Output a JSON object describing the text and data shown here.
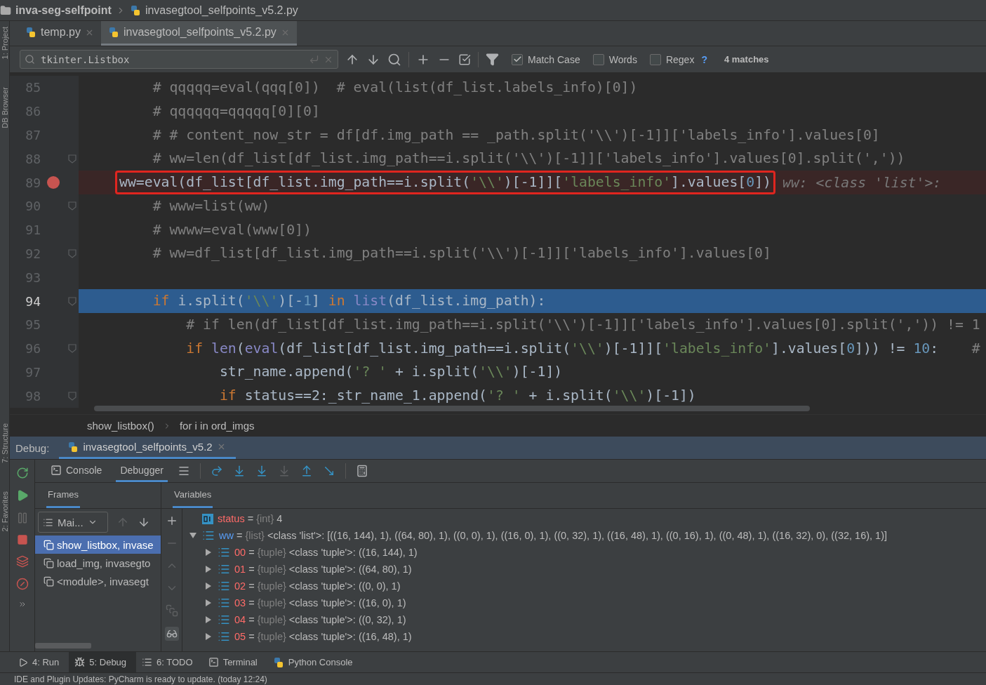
{
  "breadcrumb": {
    "project": "inva-seg-selfpoint",
    "file": "invasegtool_selfpoints_v5.2.py"
  },
  "left_strip": [
    {
      "label": "1: Project"
    },
    {
      "label": "DB Browser"
    },
    {
      "label": "7: Structure"
    },
    {
      "label": "2: Favorites"
    }
  ],
  "editor_tabs": [
    {
      "label": "temp.py",
      "selected": false
    },
    {
      "label": "invasegtool_selfpoints_v5.2.py",
      "selected": true
    }
  ],
  "find_bar": {
    "value": "tkinter.Listbox",
    "options": [
      {
        "label": "Match Case",
        "checked": true
      },
      {
        "label": "Words",
        "checked": false
      },
      {
        "label": "Regex",
        "checked": false
      }
    ],
    "help": "?",
    "matches": "4 matches"
  },
  "code_lines": [
    {
      "number": "85",
      "fold": false,
      "breakpoint": false,
      "current": false,
      "boxed": false,
      "tokens": [
        {
          "kind": "comment",
          "text": "    # qqqqq=eval(qqq[0])  # eval(list(df_list.labels_info)[0])"
        }
      ]
    },
    {
      "number": "86",
      "fold": false,
      "breakpoint": false,
      "current": false,
      "boxed": false,
      "tokens": [
        {
          "kind": "comment",
          "text": "    # qqqqqq=qqqqq[0][0]"
        }
      ]
    },
    {
      "number": "87",
      "fold": false,
      "breakpoint": false,
      "current": false,
      "boxed": false,
      "tokens": [
        {
          "kind": "comment",
          "text": "    # # content_now_str = df[df.img_path == _path.split('\\\\')[-1]]['labels_info'].values[0]"
        }
      ]
    },
    {
      "number": "88",
      "fold": true,
      "breakpoint": false,
      "current": false,
      "boxed": false,
      "tokens": [
        {
          "kind": "comment",
          "text": "    # ww=len(df_list[df_list.img_path==i.split('\\\\')[-1]]['labels_info'].values[0].split(','))"
        }
      ]
    },
    {
      "number": "89",
      "fold": false,
      "breakpoint": true,
      "current": false,
      "boxed": true,
      "hint": "ww: <class 'list'>:",
      "tokens": [
        {
          "kind": "plain",
          "text": "ww=eval(df_list[df_list.img_path==i.split("
        },
        {
          "kind": "string",
          "text": "'\\\\'"
        },
        {
          "kind": "plain",
          "text": ")[-1]]["
        },
        {
          "kind": "string",
          "text": "'labels_info'"
        },
        {
          "kind": "plain",
          "text": "].values["
        },
        {
          "kind": "number",
          "text": "0"
        },
        {
          "kind": "plain",
          "text": "])"
        }
      ]
    },
    {
      "number": "90",
      "fold": true,
      "breakpoint": false,
      "current": false,
      "boxed": false,
      "tokens": [
        {
          "kind": "comment",
          "text": "    # www=list(ww)"
        }
      ]
    },
    {
      "number": "91",
      "fold": false,
      "breakpoint": false,
      "current": false,
      "boxed": false,
      "tokens": [
        {
          "kind": "comment",
          "text": "    # wwww=eval(www[0])"
        }
      ]
    },
    {
      "number": "92",
      "fold": true,
      "breakpoint": false,
      "current": false,
      "boxed": false,
      "tokens": [
        {
          "kind": "comment",
          "text": "    # ww=df_list[df_list.img_path==i.split('\\\\')[-1]]['labels_info'].values[0]"
        }
      ]
    },
    {
      "number": "93",
      "fold": false,
      "breakpoint": false,
      "current": false
    },
    {
      "number": "94",
      "fold": true,
      "breakpoint": false,
      "current": true,
      "boxed": false,
      "tokens": [
        {
          "kind": "keyword",
          "text": "    if"
        },
        {
          "kind": "plain",
          "text": " i.split("
        },
        {
          "kind": "string",
          "text": "'\\\\'"
        },
        {
          "kind": "plain",
          "text": ")[-"
        },
        {
          "kind": "number",
          "text": "1"
        },
        {
          "kind": "plain",
          "text": "] "
        },
        {
          "kind": "keyword",
          "text": "in"
        },
        {
          "kind": "builtin",
          "text": " list"
        },
        {
          "kind": "plain",
          "text": "(df_list.img_path):"
        }
      ]
    },
    {
      "number": "95",
      "fold": false,
      "breakpoint": false,
      "current": false,
      "boxed": false,
      "tokens": [
        {
          "kind": "comment",
          "text": "        # if len(df_list[df_list.img_path==i.split('\\\\')[-1]]['labels_info'].values[0].split(',')) != 1"
        }
      ]
    },
    {
      "number": "96",
      "fold": true,
      "breakpoint": false,
      "current": false,
      "boxed": false,
      "tokens": [
        {
          "kind": "keyword",
          "text": "        if"
        },
        {
          "kind": "builtin",
          "text": " len"
        },
        {
          "kind": "plain",
          "text": "("
        },
        {
          "kind": "builtin",
          "text": "eval"
        },
        {
          "kind": "plain",
          "text": "(df_list[df_list.img_path==i.split("
        },
        {
          "kind": "string",
          "text": "'\\\\'"
        },
        {
          "kind": "plain",
          "text": ")[-1]]["
        },
        {
          "kind": "string",
          "text": "'labels_info'"
        },
        {
          "kind": "plain",
          "text": "].values["
        },
        {
          "kind": "number",
          "text": "0"
        },
        {
          "kind": "plain",
          "text": "])) != "
        },
        {
          "kind": "number",
          "text": "10"
        },
        {
          "kind": "plain",
          "text": ":    "
        },
        {
          "kind": "comment",
          "text": "#"
        }
      ]
    },
    {
      "number": "97",
      "fold": false,
      "breakpoint": false,
      "current": false,
      "boxed": false,
      "tokens": [
        {
          "kind": "plain",
          "text": "            str_name.append("
        },
        {
          "kind": "string",
          "text": "'? '"
        },
        {
          "kind": "plain",
          "text": " + i.split("
        },
        {
          "kind": "string",
          "text": "'\\\\'"
        },
        {
          "kind": "plain",
          "text": ")[-1])"
        }
      ]
    },
    {
      "number": "98",
      "fold": true,
      "breakpoint": false,
      "current": false,
      "boxed": false,
      "tokens": [
        {
          "kind": "keyword",
          "text": "            if"
        },
        {
          "kind": "plain",
          "text": " status==2:_str_name_1.append("
        },
        {
          "kind": "string",
          "text": "'? '"
        },
        {
          "kind": "plain",
          "text": " + i.split("
        },
        {
          "kind": "string",
          "text": "'\\\\'"
        },
        {
          "kind": "plain",
          "text": ")[-1])"
        }
      ]
    }
  ],
  "code_breadcrumb": [
    "show_listbox()",
    "for i in ord_imgs"
  ],
  "debug": {
    "label": "Debug:",
    "session": {
      "label": "invasegtool_selfpoints_v5.2",
      "selected": true
    },
    "tabs": [
      {
        "label": "Console",
        "selected": false
      },
      {
        "label": "Debugger",
        "selected": true
      }
    ],
    "frames_title": "Frames",
    "thread": "Mai...",
    "frames": [
      {
        "label": "show_listbox, invase",
        "selected": true
      },
      {
        "label": "load_img, invasegto",
        "selected": false
      },
      {
        "label": "<module>, invasegt",
        "selected": false
      }
    ],
    "variables_title": "Variables",
    "variables": [
      {
        "name": "status",
        "kind": "int",
        "color": "#ff6b68",
        "sign": "=",
        "type": "{int}",
        "value": "4"
      },
      {
        "name": "ww",
        "kind": "list",
        "color": "#589df6",
        "sign": "=",
        "type": "{list}",
        "value": "<class 'list'>: [((16, 144), 1), ((64, 80), 1), ((0, 0), 1), ((16, 0), 1), ((0, 32), 1), ((16, 48), 1), ((0, 16), 1), ((0, 48), 1), ((16, 32), 0), ((32, 16), 1)]",
        "expanded": true,
        "children": [
          {
            "name": "00",
            "kind": "list",
            "color": "#ff6b68",
            "sign": "=",
            "type": "{tuple}",
            "value": "<class 'tuple'>: ((16, 144), 1)",
            "expanded": false
          },
          {
            "name": "01",
            "kind": "list",
            "color": "#ff6b68",
            "sign": "=",
            "type": "{tuple}",
            "value": "<class 'tuple'>: ((64, 80), 1)",
            "expanded": false
          },
          {
            "name": "02",
            "kind": "list",
            "color": "#ff6b68",
            "sign": "=",
            "type": "{tuple}",
            "value": "<class 'tuple'>: ((0, 0), 1)",
            "expanded": false
          },
          {
            "name": "03",
            "kind": "list",
            "color": "#ff6b68",
            "sign": "=",
            "type": "{tuple}",
            "value": "<class 'tuple'>: ((16, 0), 1)",
            "expanded": false
          },
          {
            "name": "04",
            "kind": "list",
            "color": "#ff6b68",
            "sign": "=",
            "type": "{tuple}",
            "value": "<class 'tuple'>: ((0, 32), 1)",
            "expanded": false
          },
          {
            "name": "05",
            "kind": "list",
            "color": "#ff6b68",
            "sign": "=",
            "type": "{tuple}",
            "value": "<class 'tuple'>: ((16, 48), 1)",
            "expanded": false
          }
        ]
      }
    ]
  },
  "tool_windows": [
    {
      "label": "4: Run",
      "kind": "run",
      "selected": false
    },
    {
      "label": "5: Debug",
      "kind": "debug",
      "selected": true
    },
    {
      "label": "6: TODO",
      "kind": "todo",
      "selected": false
    },
    {
      "label": "Terminal",
      "kind": "terminal",
      "selected": false
    },
    {
      "label": "Python Console",
      "kind": "console",
      "selected": false
    }
  ],
  "status_bar": "IDE and Plugin Updates: PyCharm is ready to update. (today 12:24)"
}
